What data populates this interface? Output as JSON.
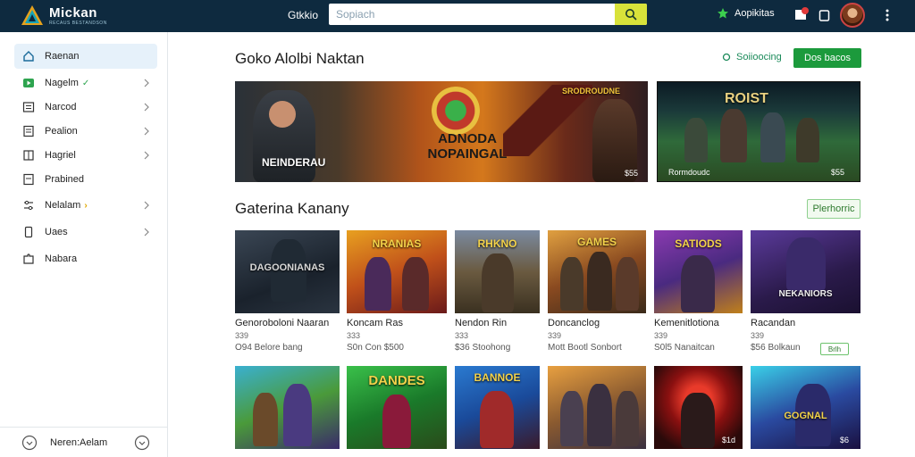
{
  "app": {
    "logo_title": "Mickan",
    "logo_subtitle": "RECAUS BESTANDSON",
    "top_link": "Gtkkio",
    "search_placeholder": "Sopiach",
    "favorites_label": "Aopikitas",
    "notification_count": "9"
  },
  "sidebar": {
    "items": [
      {
        "label": "Raenan",
        "icon": "home-icon",
        "active": true,
        "badge": "",
        "chevron": false
      },
      {
        "label": "Nagelm",
        "icon": "play-icon",
        "active": false,
        "badge": "✓",
        "chevron": true
      },
      {
        "label": "Narcod",
        "icon": "list-icon",
        "active": false,
        "badge": "",
        "chevron": true
      },
      {
        "label": "Pealion",
        "icon": "document-icon",
        "active": false,
        "badge": "",
        "chevron": true
      },
      {
        "label": "Hagriel",
        "icon": "bookmark-icon",
        "active": false,
        "badge": "",
        "chevron": true
      },
      {
        "label": "Prabined",
        "icon": "document-icon",
        "active": false,
        "badge": "",
        "chevron": false
      },
      {
        "label": "Nelalam",
        "icon": "sliders-icon",
        "active": false,
        "badge": "›",
        "chevron": true
      },
      {
        "label": "Uaes",
        "icon": "phone-icon",
        "active": false,
        "badge": "",
        "chevron": true
      },
      {
        "label": "Nabara",
        "icon": "puzzle-icon",
        "active": false,
        "badge": "",
        "chevron": false
      }
    ],
    "footer_label": "Neren:Aelam"
  },
  "featured": {
    "title": "Goko Alolbi Naktan",
    "view_link": "Soiioocing",
    "button": "Dos bacos",
    "banners": [
      {
        "title": "ADNODA NOPAINGAL",
        "left_label": "NEINDERAU",
        "top_label": "SRODROUDNE",
        "corner": "$55"
      },
      {
        "title": "ROIST",
        "left_label": "Rormdoudc",
        "corner": "$55"
      }
    ]
  },
  "catalog": {
    "title": "Gaterina Kanany",
    "button": "Plerhorric",
    "row1": [
      {
        "thumb": "DAGOONIANAS",
        "title": "Genoroboloni Naaran",
        "num": "339",
        "meta": "O94 Belore bang",
        "badge": ""
      },
      {
        "thumb": "NRANIAS",
        "title": "Koncam Ras",
        "num": "333",
        "meta": "S0n Con $500",
        "badge": ""
      },
      {
        "thumb": "RHKNO",
        "title": "Nendon Rin",
        "num": "333",
        "meta": "$36 Stoohong",
        "badge": ""
      },
      {
        "thumb": "GAMES",
        "title": "Doncanclog",
        "num": "339",
        "meta": "Mott Bootl Sonbort",
        "badge": ""
      },
      {
        "thumb": "SATIODS",
        "title": "Kemenitlotiona",
        "num": "339",
        "meta": "S0l5 Nanaitcan",
        "badge": ""
      },
      {
        "thumb": "NEKANIORS",
        "title": "Racandan",
        "num": "339",
        "meta": "$56 Bolkaun",
        "badge": "Brlh"
      }
    ],
    "row2": [
      {
        "thumb": "",
        "corner": ""
      },
      {
        "thumb": "DANDES",
        "corner": ""
      },
      {
        "thumb": "BANNOE",
        "corner": ""
      },
      {
        "thumb": "",
        "corner": ""
      },
      {
        "thumb": "",
        "corner": "$1d"
      },
      {
        "thumb": "GOGNAL",
        "corner": "$6"
      }
    ]
  },
  "colors": {
    "topbar": "#0e2a3f",
    "accent_green": "#1c9a3c",
    "search_button": "#d8e23a"
  }
}
